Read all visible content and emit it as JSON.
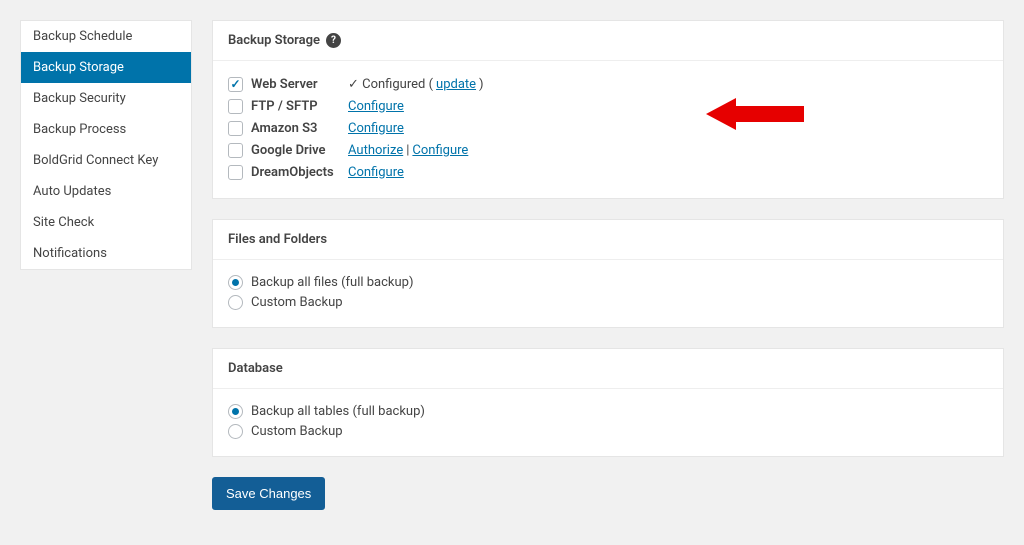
{
  "sidebar": {
    "items": [
      {
        "label": "Backup Schedule"
      },
      {
        "label": "Backup Storage"
      },
      {
        "label": "Backup Security"
      },
      {
        "label": "Backup Process"
      },
      {
        "label": "BoldGrid Connect Key"
      },
      {
        "label": "Auto Updates"
      },
      {
        "label": "Site Check"
      },
      {
        "label": "Notifications"
      }
    ],
    "activeIndex": 1
  },
  "storage": {
    "heading": "Backup Storage",
    "rows": [
      {
        "label": "Web Server",
        "checked": true,
        "status_prefix": "✓ Configured (",
        "link1": "update",
        "status_suffix": ")"
      },
      {
        "label": "FTP / SFTP",
        "checked": false,
        "link1": "Configure"
      },
      {
        "label": "Amazon S3",
        "checked": false,
        "link1": "Configure"
      },
      {
        "label": "Google Drive",
        "checked": false,
        "link1": "Authorize",
        "sep": " | ",
        "link2": "Configure"
      },
      {
        "label": "DreamObjects",
        "checked": false,
        "link1": "Configure"
      }
    ]
  },
  "files": {
    "heading": "Files and Folders",
    "options": [
      {
        "label": "Backup all files (full backup)",
        "checked": true
      },
      {
        "label": "Custom Backup",
        "checked": false
      }
    ]
  },
  "database": {
    "heading": "Database",
    "options": [
      {
        "label": "Backup all tables (full backup)",
        "checked": true
      },
      {
        "label": "Custom Backup",
        "checked": false
      }
    ]
  },
  "save_label": "Save Changes",
  "help_glyph": "?"
}
